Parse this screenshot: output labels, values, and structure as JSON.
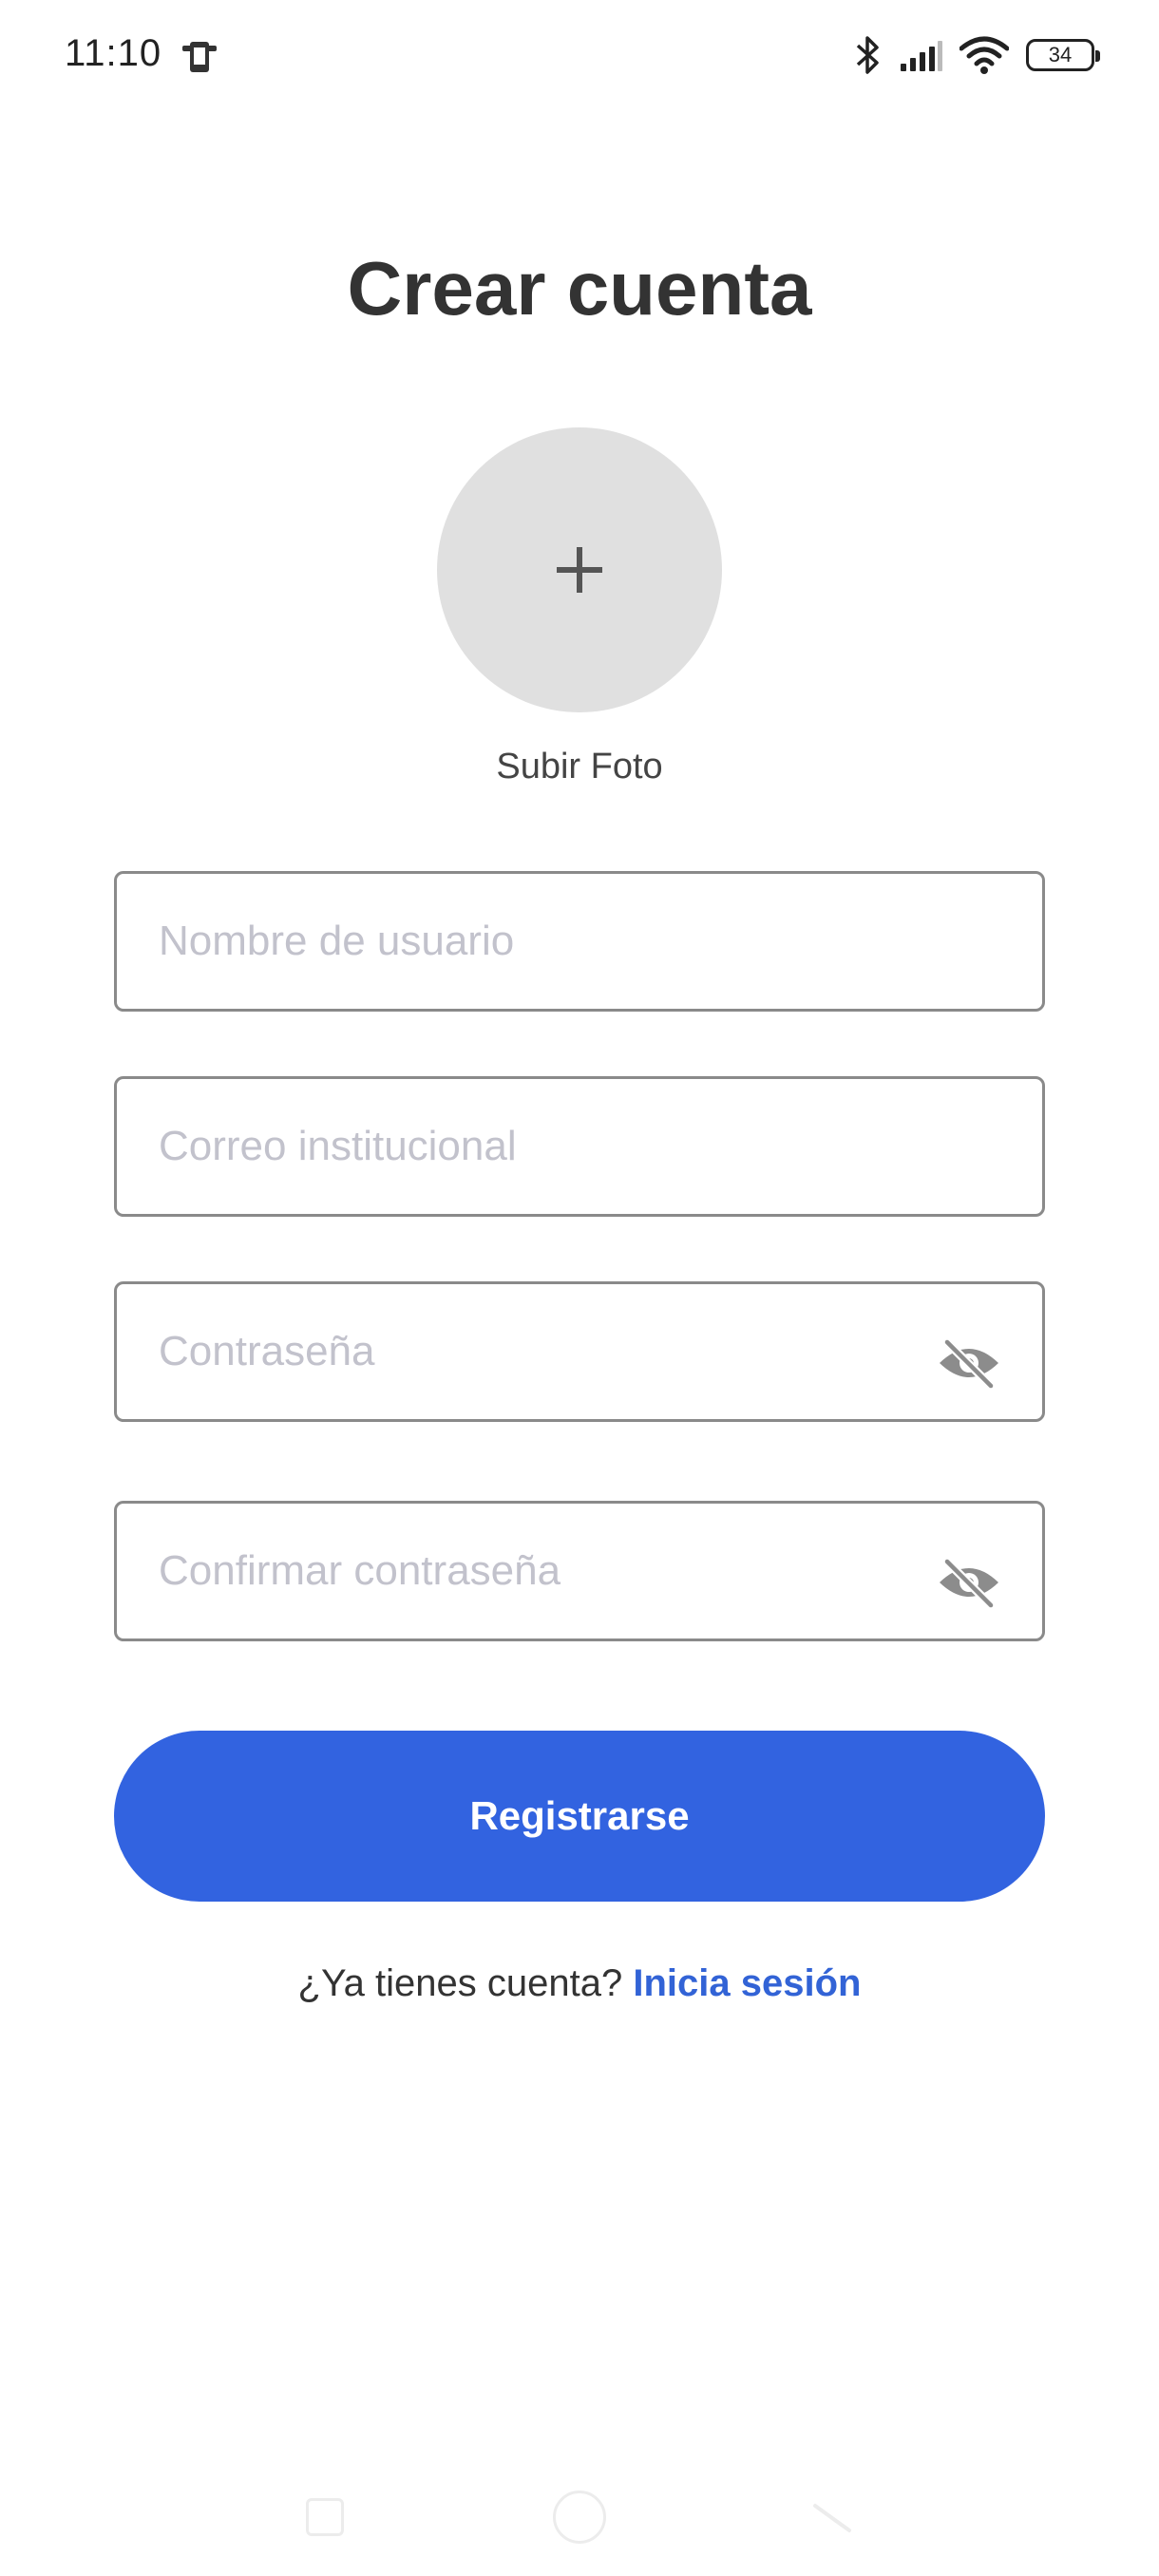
{
  "status_bar": {
    "time": "11:10",
    "battery": "34",
    "icons": [
      "notification-phone-icon",
      "bluetooth-icon",
      "signal-icon",
      "wifi-icon",
      "battery-icon"
    ]
  },
  "title": "Crear cuenta",
  "photo": {
    "label": "Subir Foto",
    "icon": "plus-icon"
  },
  "form": {
    "username_placeholder": "Nombre de usuario",
    "email_placeholder": "Correo institucional",
    "password_placeholder": "Contraseña",
    "confirm_password_placeholder": "Confirmar contraseña",
    "visibility_icon": "eye-off-icon"
  },
  "register_button": "Registrarse",
  "login_prompt": {
    "text": "¿Ya tienes cuenta? ",
    "link": "Inicia sesión"
  },
  "colors": {
    "accent": "#3263e0",
    "link": "#3263d6",
    "title": "#333333",
    "placeholder": "#c2c2cc",
    "photo_bg": "#e0e0e0"
  },
  "nav_bar": {
    "icons": [
      "recents-icon",
      "home-icon",
      "back-icon"
    ]
  }
}
